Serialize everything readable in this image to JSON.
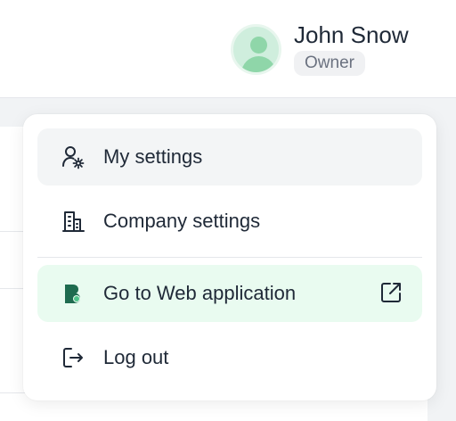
{
  "user": {
    "name": "John Snow",
    "role": "Owner"
  },
  "menu": {
    "items": [
      {
        "label": "My settings",
        "icon": "user-settings-icon"
      },
      {
        "label": "Company settings",
        "icon": "building-icon"
      },
      {
        "label": "Go to Web application",
        "icon": "app-logo-icon",
        "trailing_icon": "external-link-icon"
      },
      {
        "label": "Log out",
        "icon": "logout-icon"
      }
    ]
  },
  "colors": {
    "accent_green": "#8fd6a9",
    "web_item_bg": "#e9fbf0",
    "active_item_bg": "#f3f5f6",
    "logo_dark": "#1e6b4f",
    "logo_light": "#4fc38a"
  }
}
